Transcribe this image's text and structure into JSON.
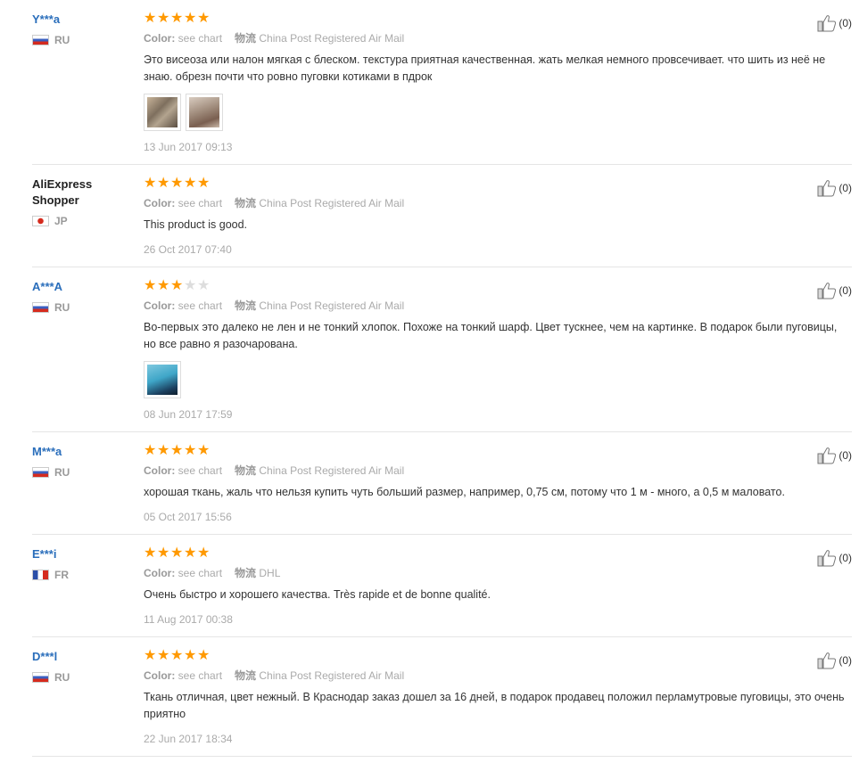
{
  "reviews": [
    {
      "name": "Y***a",
      "name_lines": [
        "Y***a"
      ],
      "country": "RU",
      "flag": "ru",
      "stars": 5,
      "color_label": "Color:",
      "color_value": "see chart",
      "ship_label": "物流",
      "shipping": "China Post Registered Air Mail",
      "text": "Это висеоза или налон мягкая с блеском. текстура приятная качественная. жать мелкая немного провсечивает. что шить из неё не знаю. обрезн почти что ровно пуговки котиками в пдрок",
      "photos": [
        "photo-beige-fabric",
        "photo-beige-fabric"
      ],
      "date": "13 Jun 2017 09:13",
      "helpful": "(0)"
    },
    {
      "name": "AliExpress Shopper",
      "name_lines": [
        "AliExpress",
        "Shopper"
      ],
      "country": "JP",
      "flag": "jp",
      "stars": 5,
      "color_label": "Color:",
      "color_value": "see chart",
      "ship_label": "物流",
      "shipping": "China Post Registered Air Mail",
      "text": "This product is good.",
      "photos": [],
      "date": "26 Oct 2017 07:40",
      "helpful": "(0)"
    },
    {
      "name": "A***A",
      "name_lines": [
        "A***A"
      ],
      "country": "RU",
      "flag": "ru",
      "stars": 3,
      "color_label": "Color:",
      "color_value": "see chart",
      "ship_label": "物流",
      "shipping": "China Post Registered Air Mail",
      "text": "Во-первых это далеко не лен и не тонкий хлопок. Похоже на тонкий шарф. Цвет тускнее, чем на картинке. В подарок были пуговицы, но все равно я разочарована.",
      "photos": [
        "photo-blue-fabric"
      ],
      "date": "08 Jun 2017 17:59",
      "helpful": "(0)"
    },
    {
      "name": "M***a",
      "name_lines": [
        "M***a"
      ],
      "country": "RU",
      "flag": "ru",
      "stars": 5,
      "color_label": "Color:",
      "color_value": "see chart",
      "ship_label": "物流",
      "shipping": "China Post Registered Air Mail",
      "text": "хорошая ткань, жаль что нельзя купить чуть больший размер, например, 0,75 см, потому что 1 м - много, а 0,5 м маловато.",
      "photos": [],
      "date": "05 Oct 2017 15:56",
      "helpful": "(0)"
    },
    {
      "name": "E***i",
      "name_lines": [
        "E***i"
      ],
      "country": "FR",
      "flag": "fr",
      "stars": 5,
      "color_label": "Color:",
      "color_value": "see chart",
      "ship_label": "物流",
      "shipping": "DHL",
      "text": "Очень быстро и хорошего качества. Très rapide et de bonne qualité.",
      "photos": [],
      "date": "11 Aug 2017 00:38",
      "helpful": "(0)"
    },
    {
      "name": "D***l",
      "name_lines": [
        "D***l"
      ],
      "country": "RU",
      "flag": "ru",
      "stars": 5,
      "color_label": "Color:",
      "color_value": "see chart",
      "ship_label": "物流",
      "shipping": "China Post Registered Air Mail",
      "text": "Ткань отличная, цвет нежный. В Краснодар заказ дошел за 16 дней, в подарок продавец положил перламутровые пуговицы, это очень приятно",
      "photos": [],
      "date": "22 Jun 2017 18:34",
      "helpful": "(0)"
    }
  ],
  "colors": {
    "star_on": "#ff9900",
    "star_off": "#dddddd",
    "buyer_link": "#2a6ebb",
    "muted": "#aaaaaa"
  }
}
